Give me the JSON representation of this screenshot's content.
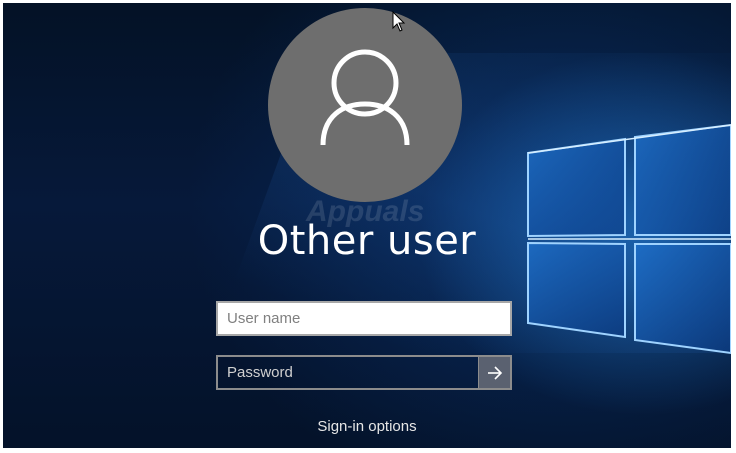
{
  "lock_screen": {
    "user_display_name": "Other user",
    "avatar_icon": "user-silhouette-icon",
    "watermark_text": "Appuals",
    "username_field": {
      "value": "",
      "placeholder": "User name"
    },
    "password_field": {
      "value": "",
      "placeholder": "Password"
    },
    "submit_icon": "arrow-right-icon",
    "sign_in_options_label": "Sign-in options"
  },
  "colors": {
    "background_dark": "#041226",
    "background_glow": "#288ce6",
    "avatar_circle": "#6e6e6e",
    "submit_button": "#5a6170",
    "text": "#ffffff"
  }
}
